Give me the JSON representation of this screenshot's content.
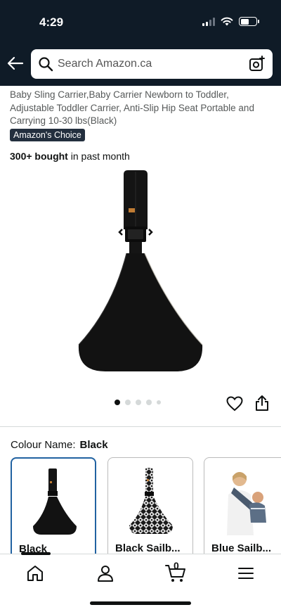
{
  "status": {
    "time": "4:29"
  },
  "search": {
    "placeholder": "Search Amazon.ca"
  },
  "product": {
    "title": "Baby Sling Carrier,Baby Carrier Newborn to Toddler, Adjustable Toddler Carrier, Anti-Slip Hip Seat Portable and Carrying 10-30 lbs(Black)",
    "badge": "Amazon's Choice",
    "bought_bold": "300+ bought",
    "bought_rest": " in past month",
    "image_count": 5,
    "current_image": 1
  },
  "variation": {
    "label": "Colour Name:",
    "selected": "Black",
    "options": [
      {
        "label": "Black"
      },
      {
        "label": "Black Sailb..."
      },
      {
        "label": "Blue Sailb..."
      }
    ]
  },
  "tabbar": {
    "cart_count": "0"
  },
  "icons": [
    "back-arrow-icon",
    "search-icon",
    "camera-icon",
    "heart-icon",
    "share-icon",
    "home-icon",
    "account-icon",
    "cart-icon",
    "menu-icon"
  ]
}
